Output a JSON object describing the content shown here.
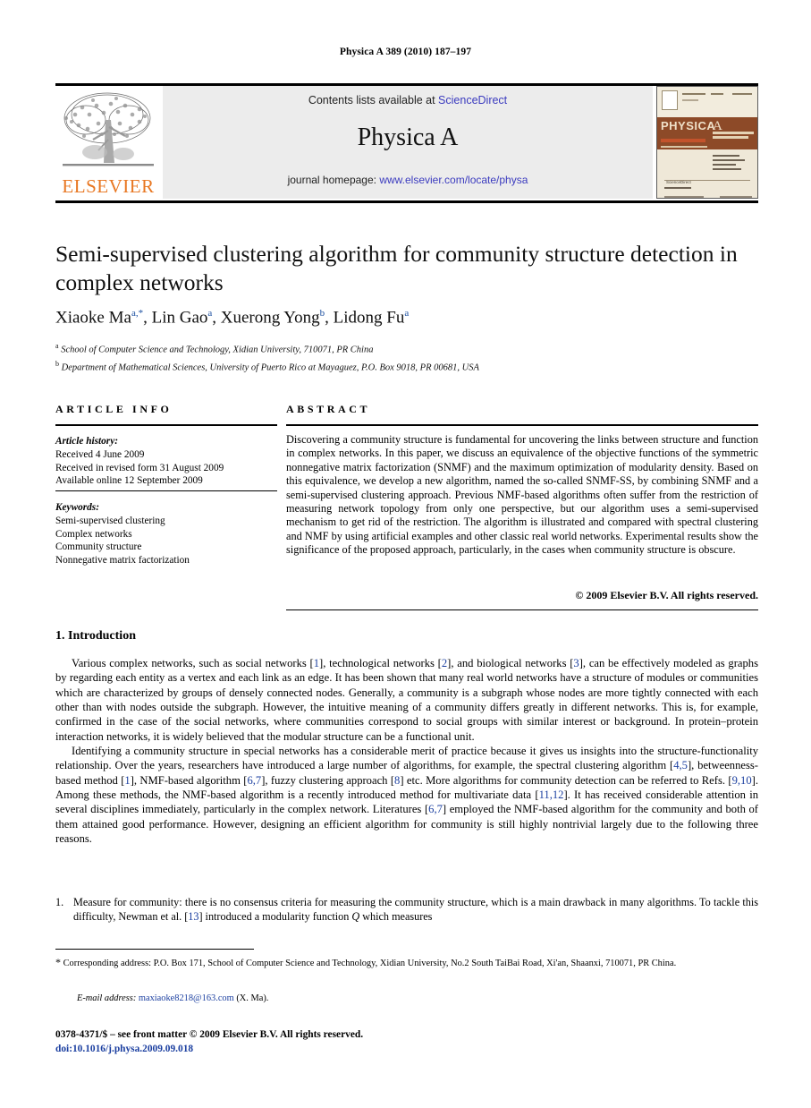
{
  "running_head": "Physica A 389 (2010) 187–197",
  "banner": {
    "publisher_logo_name": "elsevier-tree-logo",
    "publisher_wordmark": "ELSEVIER",
    "contents_prefix": "Contents lists available at ",
    "contents_link": "ScienceDirect",
    "journal_title": "Physica A",
    "homepage_prefix": "journal homepage: ",
    "homepage_url": "www.elsevier.com/locate/physa",
    "cover_title": "PHYSICA",
    "cover_letter": "A",
    "cover_subtitle": "STATISTICAL MECHANICS AND ITS APPLICATIONS",
    "cover_footer": "ScienceDirect"
  },
  "article": {
    "title": "Semi-supervised clustering algorithm for community structure detection in complex networks",
    "authors_html": "Xiaoke Ma<sup class=\"star\">a,*</sup>, Lin Gao<sup>a</sup>, Xuerong Yong<sup>b</sup>, Lidong Fu<sup>a</sup>",
    "affiliation_a": "School of Computer Science and Technology, Xidian University, 710071, PR China",
    "affiliation_b": "Department of Mathematical Sciences, University of Puerto Rico at Mayaguez, P.O. Box 9018, PR 00681, USA"
  },
  "info": {
    "header": "ARTICLE INFO",
    "history_label": "Article history:",
    "history": [
      "Received 4 June 2009",
      "Received in revised form 31 August 2009",
      "Available online 12 September 2009"
    ],
    "keywords_label": "Keywords:",
    "keywords": [
      "Semi-supervised clustering",
      "Complex networks",
      "Community structure",
      "Nonnegative matrix factorization"
    ]
  },
  "abstract": {
    "header": "ABSTRACT",
    "text": "Discovering a community structure is fundamental for uncovering the links between structure and function in complex networks. In this paper, we discuss an equivalence of the objective functions of the symmetric nonnegative matrix factorization (SNMF) and the maximum optimization of modularity density. Based on this equivalence, we develop a new algorithm, named the so-called SNMF-SS, by combining SNMF and a semi-supervised clustering approach. Previous NMF-based algorithms often suffer from the restriction of measuring network topology from only one perspective, but our algorithm uses a semi-supervised mechanism to get rid of the restriction. The algorithm is illustrated and compared with spectral clustering and NMF by using artificial examples and other classic real world networks. Experimental results show the significance of the proposed approach, particularly, in the cases when community structure is obscure.",
    "copyright": "© 2009 Elsevier B.V. All rights reserved."
  },
  "body": {
    "section_heading": "1. Introduction",
    "paragraph_1_html": "Various complex networks, such as social networks [<span class=\"ref\">1</span>], technological networks [<span class=\"ref\">2</span>], and biological networks [<span class=\"ref\">3</span>], can be effectively modeled as graphs by regarding each entity as a vertex and each link as an edge. It has been shown that many real world networks have a structure of modules or communities which are characterized by groups of densely connected nodes. Generally, a community is a subgraph whose nodes are more tightly connected with each other than with nodes outside the subgraph. However, the intuitive meaning of a community differs greatly in different networks. This is, for example, confirmed in the case of the social networks, where communities correspond to social groups with similar interest or background. In protein–protein interaction networks, it is widely believed that the modular structure can be a functional unit.",
    "paragraph_2_html": "Identifying a community structure in special networks has a considerable merit of practice because it gives us insights into the structure-functionality relationship. Over the years, researchers have introduced a large number of algorithms, for example, the spectral clustering algorithm [<span class=\"ref\">4,5</span>], betweenness-based method [<span class=\"ref\">1</span>], NMF-based algorithm [<span class=\"ref\">6,7</span>], fuzzy clustering approach [<span class=\"ref\">8</span>] etc. More algorithms for community detection can be referred to Refs. [<span class=\"ref\">9,10</span>]. Among these methods, the NMF-based algorithm is a recently introduced method for multivariate data [<span class=\"ref\">11,12</span>]. It has received considerable attention in several disciplines immediately, particularly in the complex network. Literatures [<span class=\"ref\">6,7</span>] employed the NMF-based algorithm for the community and both of them attained good performance. However, designing an efficient algorithm for community is still highly nontrivial largely due to the following three reasons.",
    "list_number": "1.",
    "list_item_html": "Measure for community: there is no consensus criteria for measuring the community structure, which is a main drawback in many algorithms. To tackle this difficulty, Newman et al. [<span class=\"ref\">13</span>] introduced a modularity function <i>Q</i> which measures"
  },
  "footer": {
    "corresponding_marker": "*",
    "corresponding_text": "Corresponding address: P.O. Box 171, School of Computer Science and Technology, Xidian University, No.2 South TaiBai Road, Xi'an, Shaanxi, 710071, PR China.",
    "email_label": "E-mail address:",
    "email_address": "maxiaoke8218@163.com",
    "email_suffix": "(X. Ma).",
    "issn_line": "0378-4371/$ – see front matter © 2009 Elsevier B.V. All rights reserved.",
    "doi_line": "doi:10.1016/j.physa.2009.09.018"
  }
}
